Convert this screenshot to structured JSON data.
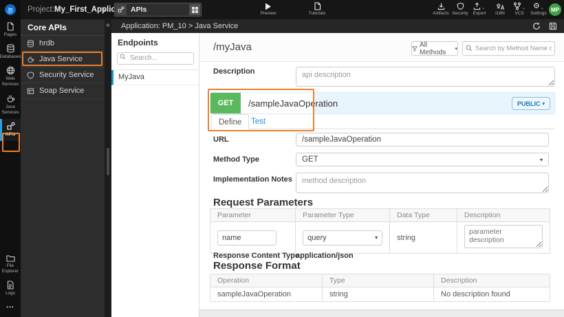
{
  "colors": {
    "annotation_orange": "#ee7f2d",
    "method_get_green": "#5cb85c",
    "accent_blue": "#1f8dd6",
    "avatar_green": "#43a047"
  },
  "topbar": {
    "project_label": "Project:",
    "project_name": "My_First_Application",
    "workspace_label": "APIs",
    "preview": "Preview",
    "tutorials": "Tutorials",
    "artifacts": "Artifacts",
    "security": "Security",
    "export": "Export",
    "i18n": "I18N",
    "vcs": "VCS",
    "settings": "Settings",
    "avatar_initials": "MP"
  },
  "rail": {
    "pages": "Pages",
    "databases": "Databases",
    "web_services": "Web Services",
    "java_services": "Java Services",
    "apis": "APIs",
    "file_explorer": "File Explorer",
    "logs": "Logs",
    "more": "•••"
  },
  "core_apis": {
    "title": "Core APIs",
    "items": [
      {
        "label": "hrdb"
      },
      {
        "label": "Java Service"
      },
      {
        "label": "Security Service"
      },
      {
        "label": "Soap Service"
      }
    ]
  },
  "gutter": {
    "collapse_glyph": "«"
  },
  "breadcrumb": {
    "text": "Application: PM_10 > Java Service"
  },
  "endpoints": {
    "title": "Endpoints",
    "search_placeholder": "Search...",
    "items": [
      {
        "label": "MyJava"
      }
    ]
  },
  "main": {
    "api_path": "/myJava",
    "filter_label": "All Methods",
    "search_placeholder": "Search by Method Name or URL...",
    "description_label": "Description",
    "description_placeholder": "api description",
    "operation": {
      "method": "GET",
      "path": "/sampleJavaOperation",
      "visibility": "PUBLIC",
      "tab_define": "Define",
      "tab_test": "Test"
    },
    "form": {
      "url_label": "URL",
      "url_value": "/sampleJavaOperation",
      "method_type_label": "Method Type",
      "method_type_value": "GET",
      "notes_label": "Implementation Notes",
      "notes_placeholder": "method description"
    },
    "request_params": {
      "title": "Request Parameters",
      "headers": [
        "Parameter",
        "Parameter Type",
        "Data Type",
        "Description"
      ],
      "row": {
        "parameter_value": "name",
        "parameter_type": "query",
        "data_type": "string",
        "description_placeholder": "parameter description"
      }
    },
    "response": {
      "content_type_label": "Response Content Type",
      "content_type_value": "application/json",
      "format_title": "Response Format",
      "headers": [
        "Operation",
        "Type",
        "Description"
      ],
      "rows": [
        [
          "sampleJavaOperation",
          "string",
          "No description found"
        ]
      ]
    }
  }
}
